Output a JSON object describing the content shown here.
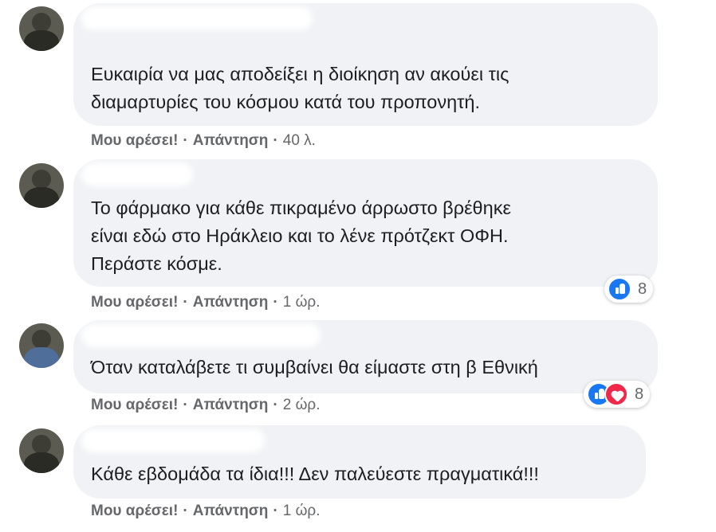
{
  "comments": [
    {
      "text": "Ευκαιρία να μας αποδείξει η διοίκηση αν ακούει τις\nδιαμαρτυρίες του κόσμου κατά του προπονητή.",
      "like_label": "Μου αρέσει!",
      "reply_label": "Απάντηση",
      "separator": "·",
      "time": "40 λ."
    },
    {
      "text": "Το φάρμακο για κάθε πικραμένο άρρωστο βρέθηκε\nείναι εδώ στο Ηράκλειο και το λένε πρότζεκτ ΟΦΗ.\nΠεράστε κόσμε.",
      "like_label": "Μου αρέσει!",
      "reply_label": "Απάντηση",
      "separator": "·",
      "time": "1 ώρ.",
      "reactions": {
        "types": [
          "like"
        ],
        "count": "8"
      }
    },
    {
      "text": "Όταν καταλάβετε τι συμβαίνει θα είμαστε στη β Εθνική",
      "like_label": "Μου αρέσει!",
      "reply_label": "Απάντηση",
      "separator": "·",
      "time": "2 ώρ.",
      "reactions": {
        "types": [
          "like",
          "love"
        ],
        "count": "8"
      }
    },
    {
      "text": "Κάθε εβδομάδα τα ίδια!!! Δεν παλεύεστε πραγματικά!!!",
      "like_label": "Μου αρέσει!",
      "reply_label": "Απάντηση",
      "separator": "·",
      "time": "1 ώρ."
    }
  ],
  "colors": {
    "bubble": "#f0f2f5",
    "meta_text": "#65676b",
    "like_blue": "#1877f2",
    "love_red": "#f02849"
  }
}
